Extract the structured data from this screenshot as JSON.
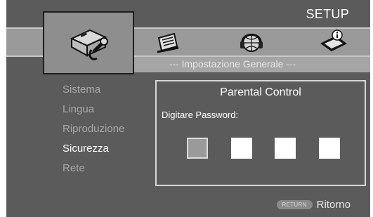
{
  "header": {
    "title": "SETUP"
  },
  "section": {
    "subtitle": "--- Impostazione Generale ---"
  },
  "tabs": [
    {
      "icon": "toolbox-icon",
      "selected": true
    },
    {
      "icon": "settings-screen-icon",
      "selected": false
    },
    {
      "icon": "globe-headphones-icon",
      "selected": false
    },
    {
      "icon": "info-book-icon",
      "selected": false
    }
  ],
  "menu": {
    "items": [
      {
        "label": "Sistema",
        "active": false
      },
      {
        "label": "Lingua",
        "active": false
      },
      {
        "label": "Riproduzione",
        "active": false
      },
      {
        "label": "Sicurezza",
        "active": true
      },
      {
        "label": "Rete",
        "active": false
      }
    ]
  },
  "dialog": {
    "title": "Parental Control",
    "prompt": "Digitare Password:",
    "password_digits": [
      "",
      "",
      "",
      ""
    ],
    "current_digit_index": 0
  },
  "footer": {
    "key_label": "RETURN",
    "action_label": "Ritorno"
  },
  "colors": {
    "background": "#5b5b5b",
    "band": "#9a9a9a",
    "text_active": "#ffffff",
    "text_inactive": "#a8a8a8"
  }
}
